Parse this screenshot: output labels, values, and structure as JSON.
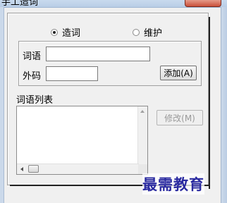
{
  "window": {
    "title": "手工造词"
  },
  "mode": {
    "options": [
      {
        "label": "造词",
        "checked": true
      },
      {
        "label": "维护",
        "checked": false
      }
    ]
  },
  "form": {
    "word_label": "词语",
    "word_value": "",
    "code_label": "外码",
    "code_value": "",
    "add_button": "添加(A)"
  },
  "list": {
    "label": "词语列表",
    "items": [],
    "modify_button": "修改(M)"
  },
  "watermark": {
    "text": "最需教育"
  },
  "colors": {
    "window_frame": "#cbd9ea",
    "close_button": "#c9503b",
    "watermark": "#2a2aa0"
  }
}
